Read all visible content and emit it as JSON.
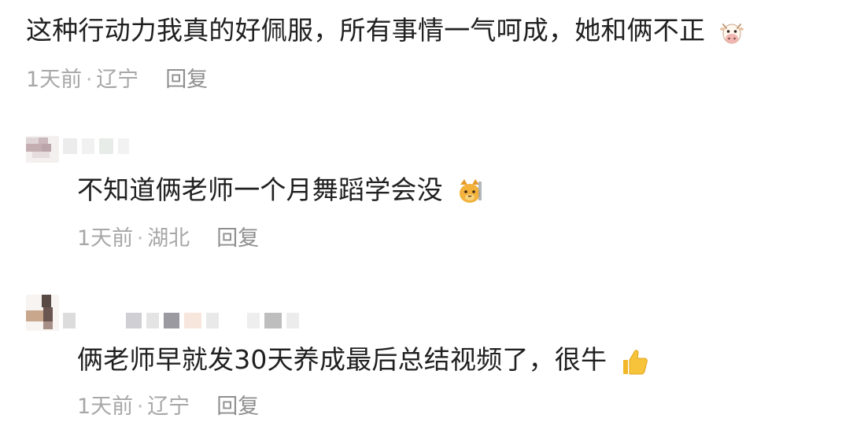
{
  "comments": [
    {
      "text": "这种行动力我真的好佩服，所有事情一气呵成，她和俩不正",
      "time": "1天前",
      "location": "辽宁",
      "reply": "回复",
      "emoji": "cow-face-icon"
    },
    {
      "text": "不知道俩老师一个月舞蹈学会没",
      "time": "1天前",
      "location": "湖北",
      "reply": "回复",
      "emoji": "cat-face-icon"
    },
    {
      "text": "俩老师早就发30天养成最后总结视频了，很牛",
      "time": "1天前",
      "location": "辽宁",
      "reply": "回复",
      "emoji": "thumbs-up-icon"
    }
  ],
  "separator": "·",
  "colors": {
    "text": "#202020",
    "meta": "#a7a7a7",
    "reply": "#8f8f8f"
  }
}
